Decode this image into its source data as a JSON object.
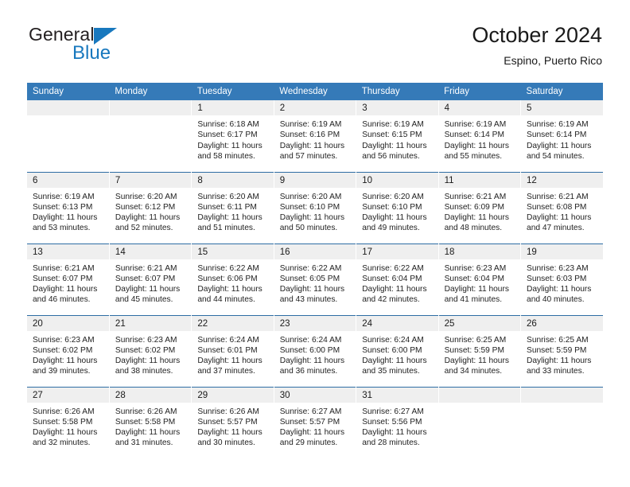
{
  "brand": {
    "name_dark": "General",
    "name_blue": "Blue",
    "accent_color": "#1878be"
  },
  "header": {
    "title": "October 2024",
    "subtitle": "Espino, Puerto Rico"
  },
  "colors": {
    "header_blue": "#357ab8",
    "row_divider": "#2e6da4",
    "daynum_bg": "#efefef"
  },
  "weekdays": [
    "Sunday",
    "Monday",
    "Tuesday",
    "Wednesday",
    "Thursday",
    "Friday",
    "Saturday"
  ],
  "labels": {
    "sunrise_prefix": "Sunrise:",
    "sunset_prefix": "Sunset:",
    "daylight_prefix": "Daylight:"
  },
  "weeks": [
    [
      {
        "day": "",
        "empty": true
      },
      {
        "day": "",
        "empty": true
      },
      {
        "day": "1",
        "sunrise": "Sunrise: 6:18 AM",
        "sunset": "Sunset: 6:17 PM",
        "daylight_l1": "Daylight: 11 hours",
        "daylight_l2": "and 58 minutes."
      },
      {
        "day": "2",
        "sunrise": "Sunrise: 6:19 AM",
        "sunset": "Sunset: 6:16 PM",
        "daylight_l1": "Daylight: 11 hours",
        "daylight_l2": "and 57 minutes."
      },
      {
        "day": "3",
        "sunrise": "Sunrise: 6:19 AM",
        "sunset": "Sunset: 6:15 PM",
        "daylight_l1": "Daylight: 11 hours",
        "daylight_l2": "and 56 minutes."
      },
      {
        "day": "4",
        "sunrise": "Sunrise: 6:19 AM",
        "sunset": "Sunset: 6:14 PM",
        "daylight_l1": "Daylight: 11 hours",
        "daylight_l2": "and 55 minutes."
      },
      {
        "day": "5",
        "sunrise": "Sunrise: 6:19 AM",
        "sunset": "Sunset: 6:14 PM",
        "daylight_l1": "Daylight: 11 hours",
        "daylight_l2": "and 54 minutes."
      }
    ],
    [
      {
        "day": "6",
        "sunrise": "Sunrise: 6:19 AM",
        "sunset": "Sunset: 6:13 PM",
        "daylight_l1": "Daylight: 11 hours",
        "daylight_l2": "and 53 minutes."
      },
      {
        "day": "7",
        "sunrise": "Sunrise: 6:20 AM",
        "sunset": "Sunset: 6:12 PM",
        "daylight_l1": "Daylight: 11 hours",
        "daylight_l2": "and 52 minutes."
      },
      {
        "day": "8",
        "sunrise": "Sunrise: 6:20 AM",
        "sunset": "Sunset: 6:11 PM",
        "daylight_l1": "Daylight: 11 hours",
        "daylight_l2": "and 51 minutes."
      },
      {
        "day": "9",
        "sunrise": "Sunrise: 6:20 AM",
        "sunset": "Sunset: 6:10 PM",
        "daylight_l1": "Daylight: 11 hours",
        "daylight_l2": "and 50 minutes."
      },
      {
        "day": "10",
        "sunrise": "Sunrise: 6:20 AM",
        "sunset": "Sunset: 6:10 PM",
        "daylight_l1": "Daylight: 11 hours",
        "daylight_l2": "and 49 minutes."
      },
      {
        "day": "11",
        "sunrise": "Sunrise: 6:21 AM",
        "sunset": "Sunset: 6:09 PM",
        "daylight_l1": "Daylight: 11 hours",
        "daylight_l2": "and 48 minutes."
      },
      {
        "day": "12",
        "sunrise": "Sunrise: 6:21 AM",
        "sunset": "Sunset: 6:08 PM",
        "daylight_l1": "Daylight: 11 hours",
        "daylight_l2": "and 47 minutes."
      }
    ],
    [
      {
        "day": "13",
        "sunrise": "Sunrise: 6:21 AM",
        "sunset": "Sunset: 6:07 PM",
        "daylight_l1": "Daylight: 11 hours",
        "daylight_l2": "and 46 minutes."
      },
      {
        "day": "14",
        "sunrise": "Sunrise: 6:21 AM",
        "sunset": "Sunset: 6:07 PM",
        "daylight_l1": "Daylight: 11 hours",
        "daylight_l2": "and 45 minutes."
      },
      {
        "day": "15",
        "sunrise": "Sunrise: 6:22 AM",
        "sunset": "Sunset: 6:06 PM",
        "daylight_l1": "Daylight: 11 hours",
        "daylight_l2": "and 44 minutes."
      },
      {
        "day": "16",
        "sunrise": "Sunrise: 6:22 AM",
        "sunset": "Sunset: 6:05 PM",
        "daylight_l1": "Daylight: 11 hours",
        "daylight_l2": "and 43 minutes."
      },
      {
        "day": "17",
        "sunrise": "Sunrise: 6:22 AM",
        "sunset": "Sunset: 6:04 PM",
        "daylight_l1": "Daylight: 11 hours",
        "daylight_l2": "and 42 minutes."
      },
      {
        "day": "18",
        "sunrise": "Sunrise: 6:23 AM",
        "sunset": "Sunset: 6:04 PM",
        "daylight_l1": "Daylight: 11 hours",
        "daylight_l2": "and 41 minutes."
      },
      {
        "day": "19",
        "sunrise": "Sunrise: 6:23 AM",
        "sunset": "Sunset: 6:03 PM",
        "daylight_l1": "Daylight: 11 hours",
        "daylight_l2": "and 40 minutes."
      }
    ],
    [
      {
        "day": "20",
        "sunrise": "Sunrise: 6:23 AM",
        "sunset": "Sunset: 6:02 PM",
        "daylight_l1": "Daylight: 11 hours",
        "daylight_l2": "and 39 minutes."
      },
      {
        "day": "21",
        "sunrise": "Sunrise: 6:23 AM",
        "sunset": "Sunset: 6:02 PM",
        "daylight_l1": "Daylight: 11 hours",
        "daylight_l2": "and 38 minutes."
      },
      {
        "day": "22",
        "sunrise": "Sunrise: 6:24 AM",
        "sunset": "Sunset: 6:01 PM",
        "daylight_l1": "Daylight: 11 hours",
        "daylight_l2": "and 37 minutes."
      },
      {
        "day": "23",
        "sunrise": "Sunrise: 6:24 AM",
        "sunset": "Sunset: 6:00 PM",
        "daylight_l1": "Daylight: 11 hours",
        "daylight_l2": "and 36 minutes."
      },
      {
        "day": "24",
        "sunrise": "Sunrise: 6:24 AM",
        "sunset": "Sunset: 6:00 PM",
        "daylight_l1": "Daylight: 11 hours",
        "daylight_l2": "and 35 minutes."
      },
      {
        "day": "25",
        "sunrise": "Sunrise: 6:25 AM",
        "sunset": "Sunset: 5:59 PM",
        "daylight_l1": "Daylight: 11 hours",
        "daylight_l2": "and 34 minutes."
      },
      {
        "day": "26",
        "sunrise": "Sunrise: 6:25 AM",
        "sunset": "Sunset: 5:59 PM",
        "daylight_l1": "Daylight: 11 hours",
        "daylight_l2": "and 33 minutes."
      }
    ],
    [
      {
        "day": "27",
        "sunrise": "Sunrise: 6:26 AM",
        "sunset": "Sunset: 5:58 PM",
        "daylight_l1": "Daylight: 11 hours",
        "daylight_l2": "and 32 minutes."
      },
      {
        "day": "28",
        "sunrise": "Sunrise: 6:26 AM",
        "sunset": "Sunset: 5:58 PM",
        "daylight_l1": "Daylight: 11 hours",
        "daylight_l2": "and 31 minutes."
      },
      {
        "day": "29",
        "sunrise": "Sunrise: 6:26 AM",
        "sunset": "Sunset: 5:57 PM",
        "daylight_l1": "Daylight: 11 hours",
        "daylight_l2": "and 30 minutes."
      },
      {
        "day": "30",
        "sunrise": "Sunrise: 6:27 AM",
        "sunset": "Sunset: 5:57 PM",
        "daylight_l1": "Daylight: 11 hours",
        "daylight_l2": "and 29 minutes."
      },
      {
        "day": "31",
        "sunrise": "Sunrise: 6:27 AM",
        "sunset": "Sunset: 5:56 PM",
        "daylight_l1": "Daylight: 11 hours",
        "daylight_l2": "and 28 minutes."
      },
      {
        "day": "",
        "empty": true
      },
      {
        "day": "",
        "empty": true
      }
    ]
  ]
}
